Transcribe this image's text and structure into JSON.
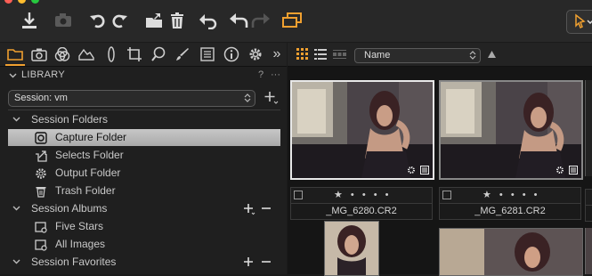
{
  "toolbar": {
    "traffic_light_colors": [
      "#ff5f56",
      "#ffbd2e",
      "#27c93f"
    ],
    "buttons": [
      "import-icon",
      "camera-icon",
      "rotate-left-icon",
      "rotate-right-icon",
      "move-to-folder-icon",
      "trash-icon",
      "reset-icon",
      "undo-icon",
      "redo-icon",
      "copy-adjustments-icon",
      "cursor-tool-icon"
    ],
    "accent": "#f0a030"
  },
  "tool_tabs": {
    "icons": [
      "library-folder-icon",
      "capture-icon",
      "color-icon",
      "exposure-icon",
      "lens-icon",
      "crop-icon",
      "focus-icon",
      "adjustments-brush-icon",
      "metadata-icon",
      "info-icon",
      "settings-gear-icon",
      "more-chevrons-icon"
    ],
    "overflow_label": "»"
  },
  "library": {
    "title": "LIBRARY",
    "help": "?",
    "more": "···",
    "session_select": "Session: vm",
    "sections": {
      "folders": "Session Folders",
      "albums": "Session Albums",
      "favorites": "Session Favorites"
    },
    "folders": [
      "Capture Folder",
      "Selects Folder",
      "Output Folder",
      "Trash Folder"
    ],
    "albums": [
      "Five Stars",
      "All Images"
    ]
  },
  "browser": {
    "sort_value": "Name",
    "view_icons": [
      "grid-view-icon",
      "list-view-icon",
      "filmstrip-view-icon"
    ],
    "thumbnails": [
      {
        "name": "_MG_6280.CR2",
        "rating": 1
      },
      {
        "name": "_MG_6281.CR2",
        "rating": 1
      }
    ],
    "star_glyphs": "★ • • • •"
  }
}
